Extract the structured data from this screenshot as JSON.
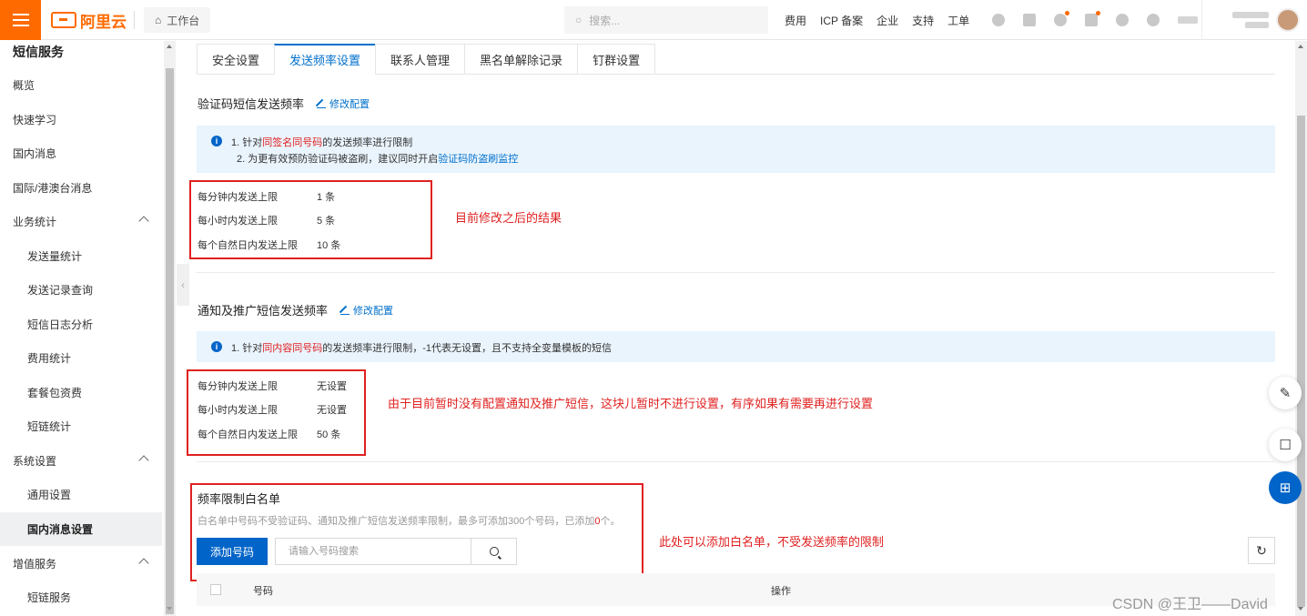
{
  "topbar": {
    "logo_text": "阿里云",
    "workbench_label": "工作台",
    "search_placeholder": "搜索...",
    "nav_items": [
      "费用",
      "ICP 备案",
      "企业",
      "支持",
      "工单"
    ]
  },
  "sidebar": {
    "title": "短信服务",
    "items": [
      {
        "label": "概览",
        "level": 1
      },
      {
        "label": "快速学习",
        "level": 1
      },
      {
        "label": "国内消息",
        "level": 1
      },
      {
        "label": "国际/港澳台消息",
        "level": 1
      },
      {
        "label": "业务统计",
        "level": 1,
        "expanded": true
      },
      {
        "label": "发送量统计",
        "level": 2
      },
      {
        "label": "发送记录查询",
        "level": 2
      },
      {
        "label": "短信日志分析",
        "level": 2
      },
      {
        "label": "费用统计",
        "level": 2
      },
      {
        "label": "套餐包资费",
        "level": 2
      },
      {
        "label": "短链统计",
        "level": 2
      },
      {
        "label": "系统设置",
        "level": 1,
        "expanded": true
      },
      {
        "label": "通用设置",
        "level": 2
      },
      {
        "label": "国内消息设置",
        "level": 2,
        "active": true
      },
      {
        "label": "增值服务",
        "level": 1,
        "expanded": true
      },
      {
        "label": "短链服务",
        "level": 2
      }
    ]
  },
  "tabs": [
    {
      "label": "安全设置",
      "active": false
    },
    {
      "label": "发送频率设置",
      "active": true
    },
    {
      "label": "联系人管理",
      "active": false
    },
    {
      "label": "黑名单解除记录",
      "active": false
    },
    {
      "label": "钉群设置",
      "active": false
    }
  ],
  "verify_section": {
    "title": "验证码短信发送频率",
    "edit_label": "修改配置",
    "notice_line1_pre": "1. 针对",
    "notice_line1_red": "同签名同号码",
    "notice_line1_post": "的发送频率进行限制",
    "notice_line2_pre": "2. 为更有效预防验证码被盗刷，建议同时开启",
    "notice_line2_link": "验证码防盗刷监控",
    "limits": [
      {
        "key": "每分钟内发送上限",
        "value": "1 条"
      },
      {
        "key": "每小时内发送上限",
        "value": "5 条"
      },
      {
        "key": "每个自然日内发送上限",
        "value": "10 条"
      }
    ],
    "annotation": "目前修改之后的结果"
  },
  "notify_section": {
    "title": "通知及推广短信发送频率",
    "edit_label": "修改配置",
    "notice_line1_pre": "1. 针对",
    "notice_line1_red": "同内容同号码",
    "notice_line1_post": "的发送频率进行限制，-1代表无设置，且不支持全变量模板的短信",
    "limits": [
      {
        "key": "每分钟内发送上限",
        "value": "无设置"
      },
      {
        "key": "每小时内发送上限",
        "value": "无设置"
      },
      {
        "key": "每个自然日内发送上限",
        "value": "50 条"
      }
    ],
    "annotation": "由于目前暂时没有配置通知及推广短信，这块儿暂时不进行设置，有序如果有需要再进行设置"
  },
  "whitelist": {
    "title": "频率限制白名单",
    "desc_pre": "白名单中号码不受验证码、通知及推广短信发送频率限制，最多可添加300个号码，已添加",
    "desc_count": "0",
    "desc_post": "个。",
    "add_button": "添加号码",
    "search_placeholder": "请输入号码搜索",
    "annotation": "此处可以添加白名单，不受发送频率的限制",
    "columns": [
      "号码",
      "操作"
    ]
  },
  "watermark": "CSDN @王卫——David",
  "colors": {
    "brand": "#ff6a00",
    "primary": "#0064c8",
    "annotation": "#e02020",
    "notice_bg": "#eaf4fd"
  }
}
